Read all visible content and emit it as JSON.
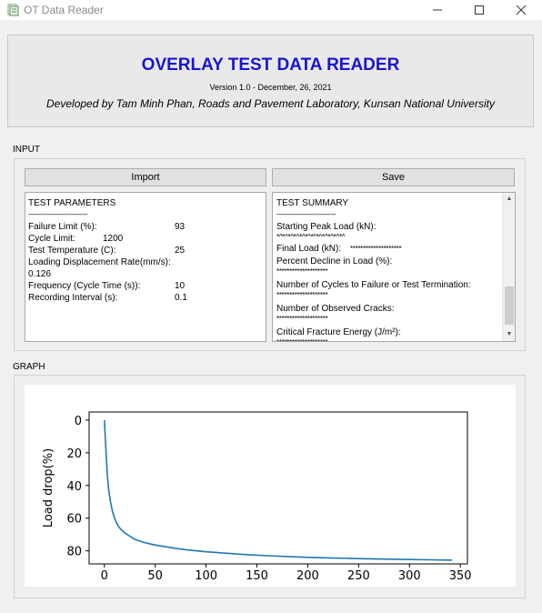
{
  "window": {
    "title": "OT Data Reader",
    "app_icon": "app-window-icon",
    "controls": {
      "minimize_icon": "minimize-icon",
      "maximize_icon": "maximize-icon",
      "close_icon": "close-icon"
    }
  },
  "header": {
    "title": "OVERLAY TEST DATA READER",
    "version": "Version 1.0 - December, 26, 2021",
    "developer": "Developed by Tam Minh Phan, Roads and Pavement Laboratory, Kunsan National University",
    "title_color": "#1a14d2"
  },
  "input_section": {
    "label": "INPUT",
    "import_label": "Import",
    "save_label": "Save"
  },
  "test_parameters": {
    "heading": "TEST PARAMETERS",
    "separator": "------------------------------",
    "failure_limit_label": "Failure Limit (%):",
    "failure_limit_value": "93",
    "cycle_limit_label": "Cycle Limit:",
    "cycle_limit_value": "1200",
    "temperature_label": "Test Temperature (C):",
    "temperature_value": "25",
    "displacement_rate_label": "Loading Displacement Rate(mm/s):",
    "displacement_rate_value": "0.126",
    "frequency_label": "Frequency (Cycle Time (s)):",
    "frequency_value": "10",
    "recording_interval_label": "Recording Interval (s):",
    "recording_interval_value": "0.1"
  },
  "test_summary": {
    "heading": "TEST SUMMARY",
    "separator": "------------------------------",
    "starting_peak_label": "Starting Peak Load (kN):",
    "starting_peak_value": "*^*^*^*^*^*^*^*^*^*^*^*^",
    "final_load_label": "Final Load (kN):",
    "final_load_value": "********************",
    "percent_decline_label": "Percent Decline in Load (%):",
    "percent_decline_value": "********************",
    "cycles_label": "Number of Cycles to Failure or Test Termination:",
    "cycles_value": "********************",
    "cracks_label": "Number of Observed Cracks:",
    "cracks_value": "********************",
    "fracture_energy_label": "Critical Fracture Energy (J/m²):",
    "fracture_energy_value": "********************",
    "scroll_up_icon": "scroll-up-arrow-icon",
    "scroll_down_icon": "scroll-down-arrow-icon"
  },
  "graph_section": {
    "label": "GRAPH"
  },
  "chart_data": {
    "type": "line",
    "title": "",
    "xlabel": "",
    "ylabel": "Load drop(%)",
    "xlim": [
      -15,
      357
    ],
    "ylim": [
      88,
      -5
    ],
    "y_inverted": true,
    "xticks": [
      0,
      50,
      100,
      150,
      200,
      250,
      300,
      350
    ],
    "yticks": [
      0,
      20,
      40,
      60,
      80
    ],
    "grid": false,
    "series": [
      {
        "color": "#1f77b4",
        "x": [
          0,
          1,
          2,
          3,
          4,
          5,
          6,
          8,
          10,
          12,
          15,
          20,
          25,
          30,
          40,
          50,
          60,
          70,
          80,
          90,
          100,
          110,
          120,
          140,
          160,
          180,
          200,
          220,
          240,
          260,
          280,
          300,
          320,
          342
        ],
        "y": [
          0,
          12,
          24,
          34,
          41,
          46,
          50,
          56,
          60,
          63,
          66,
          69,
          71,
          73,
          75,
          76.5,
          77.5,
          78.5,
          79.3,
          80,
          80.6,
          81,
          81.5,
          82.3,
          83,
          83.5,
          84,
          84.3,
          84.6,
          84.9,
          85.1,
          85.3,
          85.5,
          85.7
        ]
      }
    ]
  }
}
